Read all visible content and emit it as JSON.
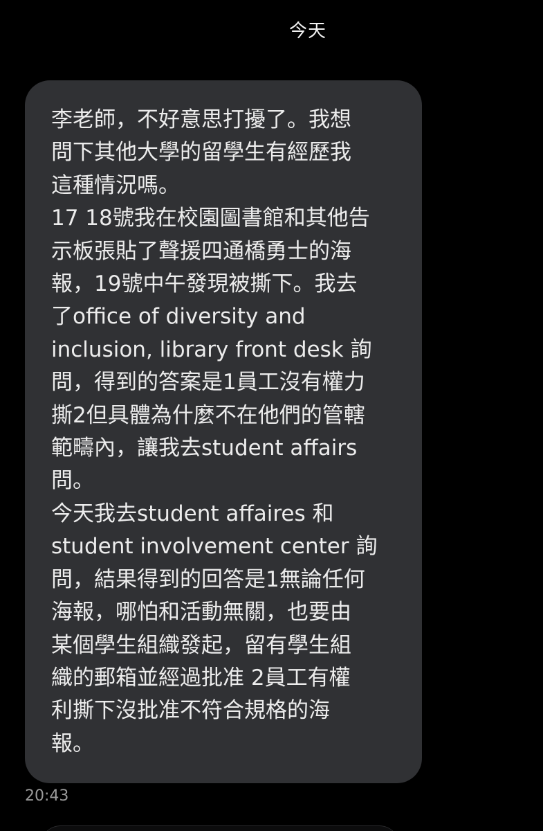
{
  "conversation": {
    "date_label": "今天",
    "message": {
      "lines": [
        "李老師，不好意思打擾了。我想",
        "問下其他大學的留學生有經歷我",
        "這種情況嗎。",
        "17 18號我在校園圖書館和其他告",
        "示板張貼了聲援四通橋勇士的海",
        "報，19號中午發現被撕下。我去",
        "了office of diversity and",
        "inclusion, library front desk 詢",
        "問，得到的答案是1員工沒有權力",
        "撕2但具體為什麼不在他們的管轄",
        "範疇內，讓我去student affairs",
        "問。",
        "今天我去student affaires 和",
        "student involvement center 詢",
        "問，結果得到的回答是1無論任何",
        "海報，哪怕和活動無關，也要由",
        "某個學生組織發起，留有學生組",
        "織的郵箱並經過批准 2員工有權",
        "利撕下沒批准不符合規格的海",
        "報。"
      ],
      "timestamp": "20:43"
    }
  },
  "colors": {
    "background": "#000000",
    "bubble": "#303134",
    "text": "#ececec",
    "timestamp": "#9a9a9a"
  }
}
